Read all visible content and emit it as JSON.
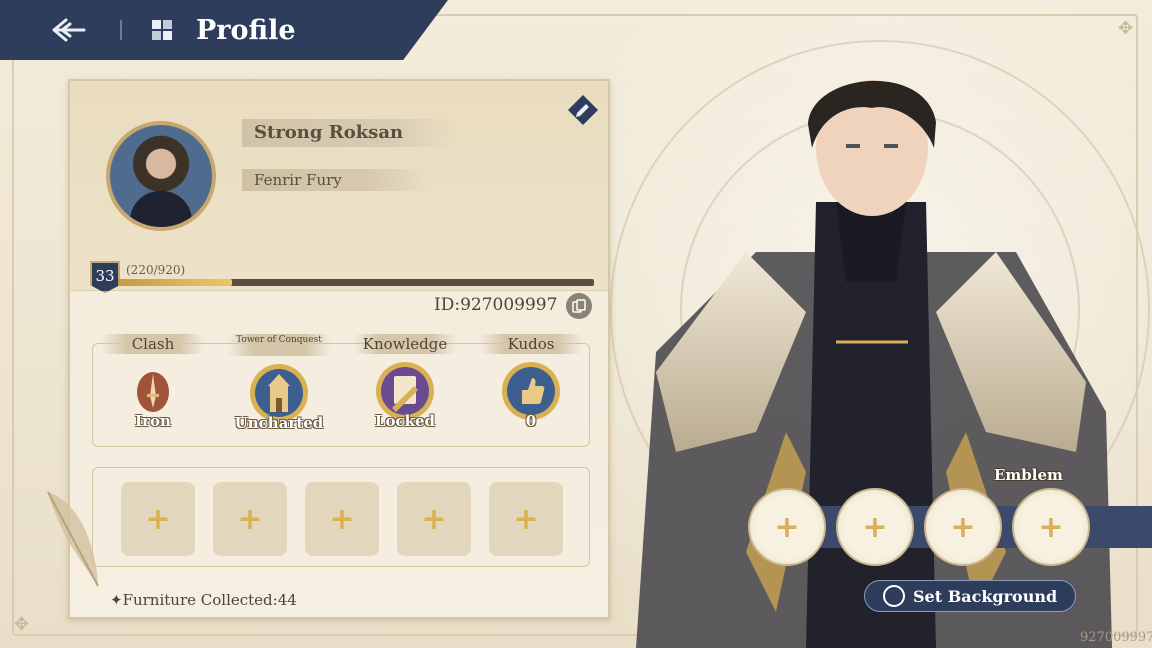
{
  "header": {
    "title": "Profile"
  },
  "profile": {
    "name": "Strong Roksan",
    "title": "Fenrir Fury",
    "level": "33",
    "exp_text": "(220/920)",
    "exp_progress": 0.239,
    "uid": "ID:927009997"
  },
  "stats": [
    {
      "label": "Clash",
      "value": "Iron",
      "icon": "sword-icon",
      "color": "#a0543a"
    },
    {
      "label": "Tower of Conquest",
      "value": "Uncharted",
      "icon": "tower-icon",
      "color": "#3d5f8f"
    },
    {
      "label": "Knowledge",
      "value": "Locked",
      "icon": "scroll-quill-icon",
      "color": "#6b4b8f"
    },
    {
      "label": "Kudos",
      "value": "0",
      "icon": "thumbs-up-icon",
      "color": "#3d5f8f"
    }
  ],
  "furniture": {
    "text": "✦Furniture Collected:44"
  },
  "emblem": {
    "label": "Emblem"
  },
  "buttons": {
    "set_background": "Set Background"
  },
  "corner_uid": "927009997",
  "colors": {
    "header_navy": "#2f3d5c",
    "gold": "#d9b153",
    "parchment": "#efe6d2"
  }
}
